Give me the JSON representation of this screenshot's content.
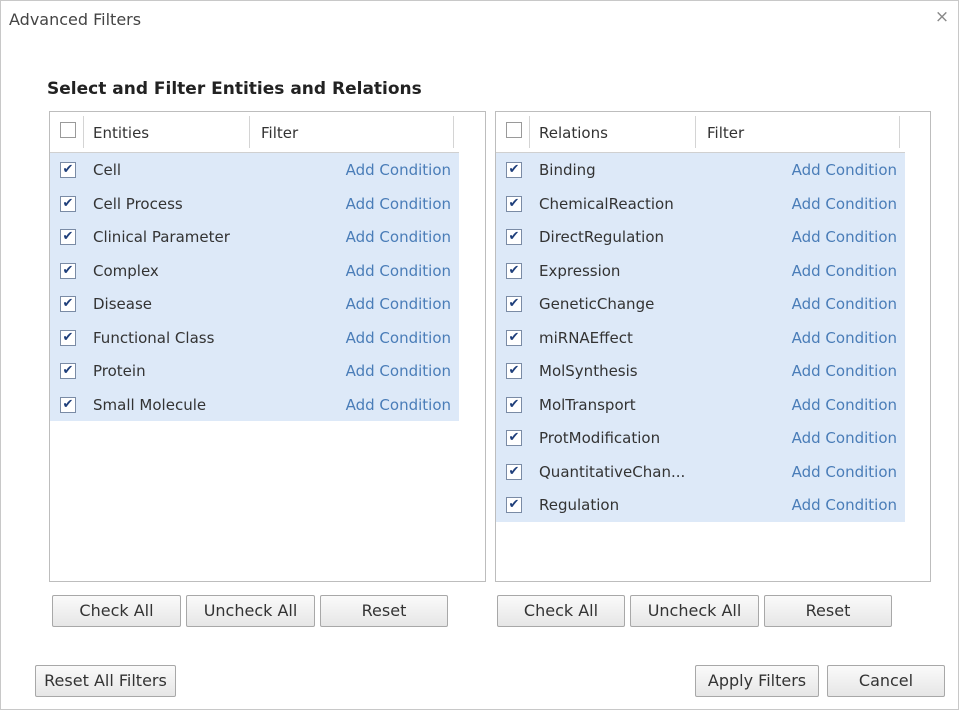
{
  "dialog": {
    "title": "Advanced Filters",
    "close_glyph": "×",
    "section_title": "Select and Filter Entities and Relations"
  },
  "entities": {
    "header": {
      "name": "Entities",
      "filter": "Filter",
      "all_checked": false
    },
    "rows": [
      {
        "name": "Cell",
        "action": "Add Condition",
        "checked": true
      },
      {
        "name": "Cell Process",
        "action": "Add Condition",
        "checked": true
      },
      {
        "name": "Clinical Parameter",
        "action": "Add Condition",
        "checked": true
      },
      {
        "name": "Complex",
        "action": "Add Condition",
        "checked": true
      },
      {
        "name": "Disease",
        "action": "Add Condition",
        "checked": true
      },
      {
        "name": "Functional Class",
        "action": "Add Condition",
        "checked": true
      },
      {
        "name": "Protein",
        "action": "Add Condition",
        "checked": true
      },
      {
        "name": "Small Molecule",
        "action": "Add Condition",
        "checked": true
      }
    ],
    "buttons": {
      "check_all": "Check All",
      "uncheck_all": "Uncheck All",
      "reset": "Reset"
    }
  },
  "relations": {
    "header": {
      "name": "Relations",
      "filter": "Filter",
      "all_checked": false
    },
    "rows": [
      {
        "name": "Binding",
        "action": "Add Condition",
        "checked": true
      },
      {
        "name": "ChemicalReaction",
        "action": "Add Condition",
        "checked": true
      },
      {
        "name": "DirectRegulation",
        "action": "Add Condition",
        "checked": true
      },
      {
        "name": "Expression",
        "action": "Add Condition",
        "checked": true
      },
      {
        "name": "GeneticChange",
        "action": "Add Condition",
        "checked": true
      },
      {
        "name": "miRNAEffect",
        "action": "Add Condition",
        "checked": true
      },
      {
        "name": "MolSynthesis",
        "action": "Add Condition",
        "checked": true
      },
      {
        "name": "MolTransport",
        "action": "Add Condition",
        "checked": true
      },
      {
        "name": "ProtModification",
        "action": "Add Condition",
        "checked": true
      },
      {
        "name": "QuantitativeChan...",
        "action": "Add Condition",
        "checked": true
      },
      {
        "name": "Regulation",
        "action": "Add Condition",
        "checked": true
      }
    ],
    "buttons": {
      "check_all": "Check All",
      "uncheck_all": "Uncheck All",
      "reset": "Reset"
    }
  },
  "footer": {
    "reset_all": "Reset All Filters",
    "apply": "Apply Filters",
    "cancel": "Cancel"
  },
  "colors": {
    "row_selected": "#dde9f8",
    "link": "#4a7db8",
    "check": "#1e3e7a"
  }
}
